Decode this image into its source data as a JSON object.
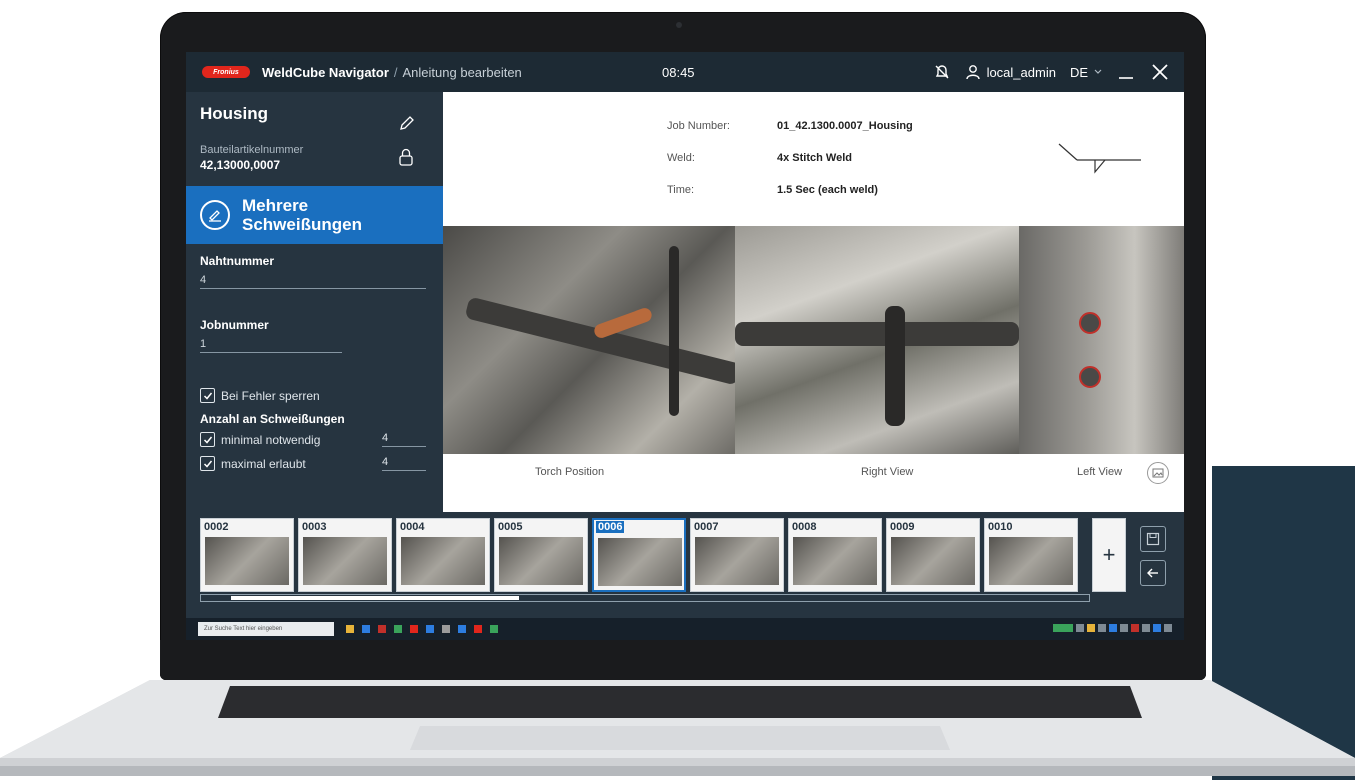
{
  "header": {
    "logo_text": "Fronius",
    "app_title": "WeldCube Navigator",
    "separator": "/",
    "breadcrumb": "Anleitung bearbeiten",
    "clock": "08:45",
    "username": "local_admin",
    "language": "DE",
    "icons": [
      "notification-off-icon",
      "user-icon",
      "chevron-down-icon",
      "minimize-icon",
      "close-icon"
    ]
  },
  "sidebar": {
    "part_title": "Housing",
    "part_number_label": "Bauteilartikelnummer",
    "part_number": "42,13000,0007",
    "mode_line1": "Mehrere",
    "mode_line2": "Schweißungen",
    "seam_label": "Nahtnummer",
    "seam_value": "4",
    "job_label": "Jobnummer",
    "job_value": "1",
    "lock_on_error": "Bei Fehler sperren",
    "weld_count_label": "Anzahl an Schweißungen",
    "min_label": "minimal notwendig",
    "min_value": "4",
    "max_label": "maximal erlaubt",
    "max_value": "4",
    "checked": [
      true,
      true,
      true
    ]
  },
  "main": {
    "rows": [
      {
        "key": "Job Number:",
        "value": "01_42.1300.0007_Housing"
      },
      {
        "key": "Weld:",
        "value": "4x Stitch Weld"
      },
      {
        "key": "Time:",
        "value": "1.5 Sec (each weld)"
      }
    ],
    "captions": [
      "Torch Position",
      "Right View",
      "Left View"
    ]
  },
  "filmstrip": {
    "steps": [
      "0002",
      "0003",
      "0004",
      "0005",
      "0006",
      "0007",
      "0008",
      "0009",
      "0010"
    ],
    "active_index": 4,
    "add_label": "+"
  },
  "taskbar": {
    "search_placeholder": "Zur Suche Text hier eingeben"
  },
  "colors": {
    "accent": "#1a6fbf",
    "app_background": "#263440",
    "decor_block": "#1f3646",
    "logo_red": "#e1261c"
  }
}
